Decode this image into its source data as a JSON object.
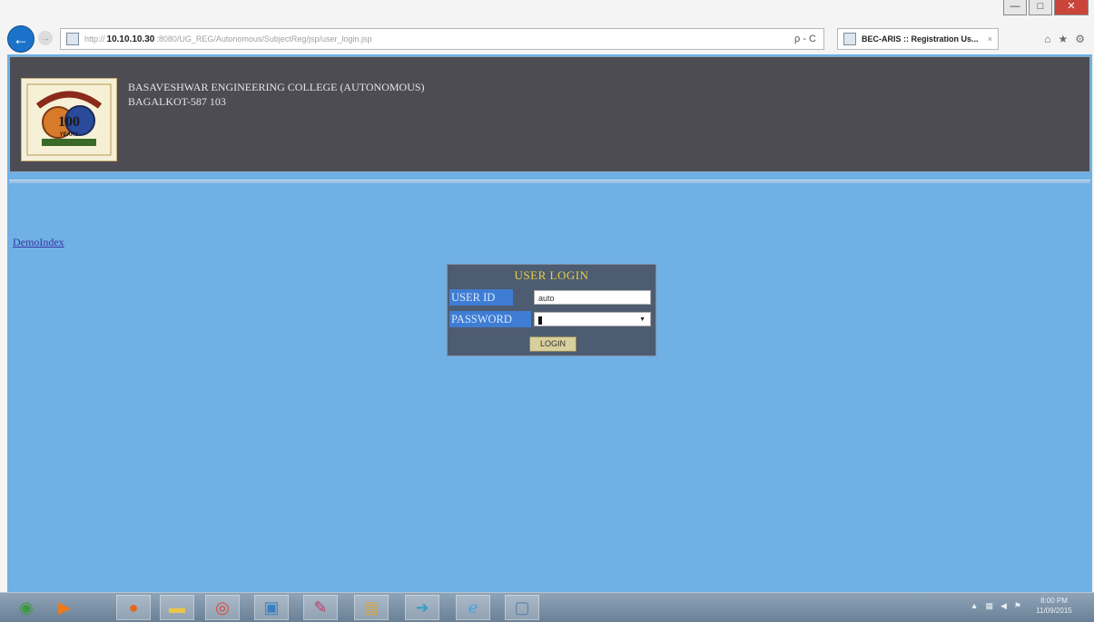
{
  "browser": {
    "url_host": "10.10.10.30",
    "url_path": ":8080/UG_REG/Autonomous/SubjectReg/jsp/user_login.jsp",
    "url_scheme": "http://",
    "tab_title": "BEC-ARIS :: Registration Us...",
    "search_glyph": "ρ - C",
    "window_controls": [
      "—",
      "□",
      "✕"
    ],
    "toolbar_icons": [
      "⌂",
      "★",
      "⚙"
    ]
  },
  "header": {
    "college_name": "BASAVESHWAR ENGINEERING COLLEGE (AUTONOMOUS)",
    "address": "BAGALKOT-587 103",
    "logo_text": "100",
    "logo_sub": "YEARS"
  },
  "links": {
    "demo": "DemoIndex"
  },
  "login": {
    "title": "USER LOGIN",
    "user_id_label": "USER ID",
    "password_label": "PASSWORD",
    "user_id_value": "auto",
    "button_label": "LOGIN"
  },
  "taskbar": {
    "items": [
      {
        "icon": "start-orb-icon",
        "glyph": "◉",
        "color": "#3a9a3a"
      },
      {
        "icon": "media-player-icon",
        "glyph": "▶",
        "color": "#f07a1a"
      },
      {
        "icon": "firefox-icon",
        "glyph": "●",
        "color": "#e6671c"
      },
      {
        "icon": "folder-icon",
        "glyph": "▬",
        "color": "#e9c64a"
      },
      {
        "icon": "chrome-icon",
        "glyph": "◎",
        "color": "#d84b37"
      },
      {
        "icon": "remote-desktop-icon",
        "glyph": "▣",
        "color": "#3b7fc4"
      },
      {
        "icon": "paint-icon",
        "glyph": "✎",
        "color": "#c03a6a"
      },
      {
        "icon": "files-icon",
        "glyph": "▤",
        "color": "#d9a53a"
      },
      {
        "icon": "arrow-app-icon",
        "glyph": "➜",
        "color": "#3aa0c8"
      },
      {
        "icon": "internet-explorer-icon",
        "glyph": "ℯ",
        "color": "#44a3e0"
      },
      {
        "icon": "window-app-icon",
        "glyph": "▢",
        "color": "#5a7fa6"
      }
    ],
    "clock_time": "8:00 PM",
    "clock_date": "11/09/2015"
  },
  "colors": {
    "page_bg": "#6fb0e5",
    "header_bg": "#4c4c52",
    "login_title": "#e9cf44",
    "login_label_bg": "#3e7dd3"
  }
}
